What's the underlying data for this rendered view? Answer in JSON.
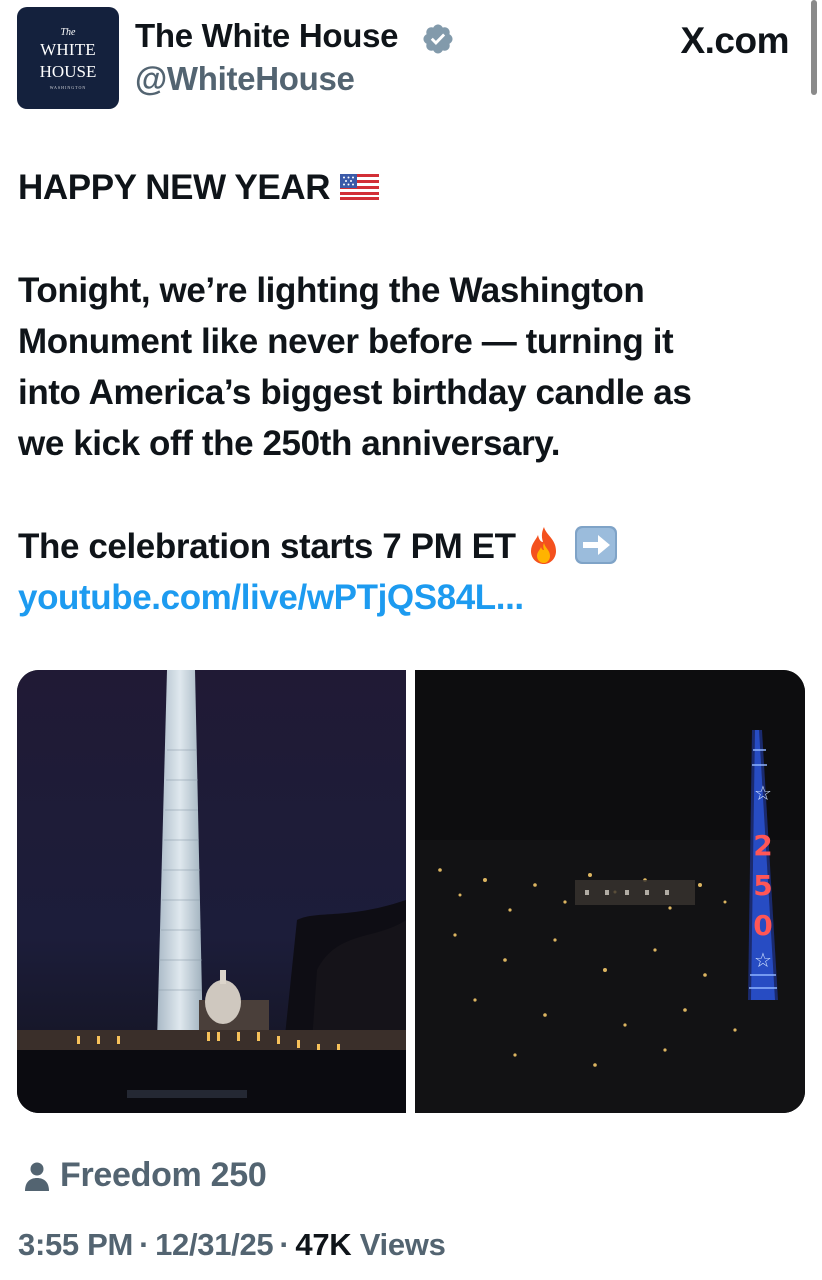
{
  "account": {
    "avatar_lines": [
      "The",
      "WHITE",
      "HOUSE",
      "WASHINGTON"
    ],
    "display_name": "The White House",
    "handle": "@WhiteHouse",
    "verified_color": "#829aab"
  },
  "site_label": "X.com",
  "post": {
    "headline": "HAPPY NEW YEAR",
    "headline_emoji": "us-flag",
    "body_lines": [
      "Tonight, we’re lighting the Washington",
      "Monument like never before — turning it",
      "into America’s biggest birthday candle as",
      "we kick off the 250th anniversary."
    ],
    "celebration": "The celebration starts 7 PM ET",
    "celebration_emojis": [
      "fire",
      "right-arrow"
    ],
    "link": "youtube.com/live/wPTjQS84L..."
  },
  "media": {
    "photos": [
      {
        "alt": "Washington Monument lit with projected text at night with the Capitol dome"
      },
      {
        "alt": "Washington Monument lit with red white and blue 250 display over the night city"
      }
    ],
    "monument_display": "250"
  },
  "context": {
    "icon": "person-icon",
    "label": "Freedom 250"
  },
  "meta": {
    "time": "3:55 PM",
    "date": "12/31/25",
    "views_count": "47K",
    "views_label": "Views",
    "separator": "·"
  },
  "colors": {
    "link": "#1d9bf0",
    "secondary_text": "#536471",
    "avatar_bg": "#14213d"
  }
}
